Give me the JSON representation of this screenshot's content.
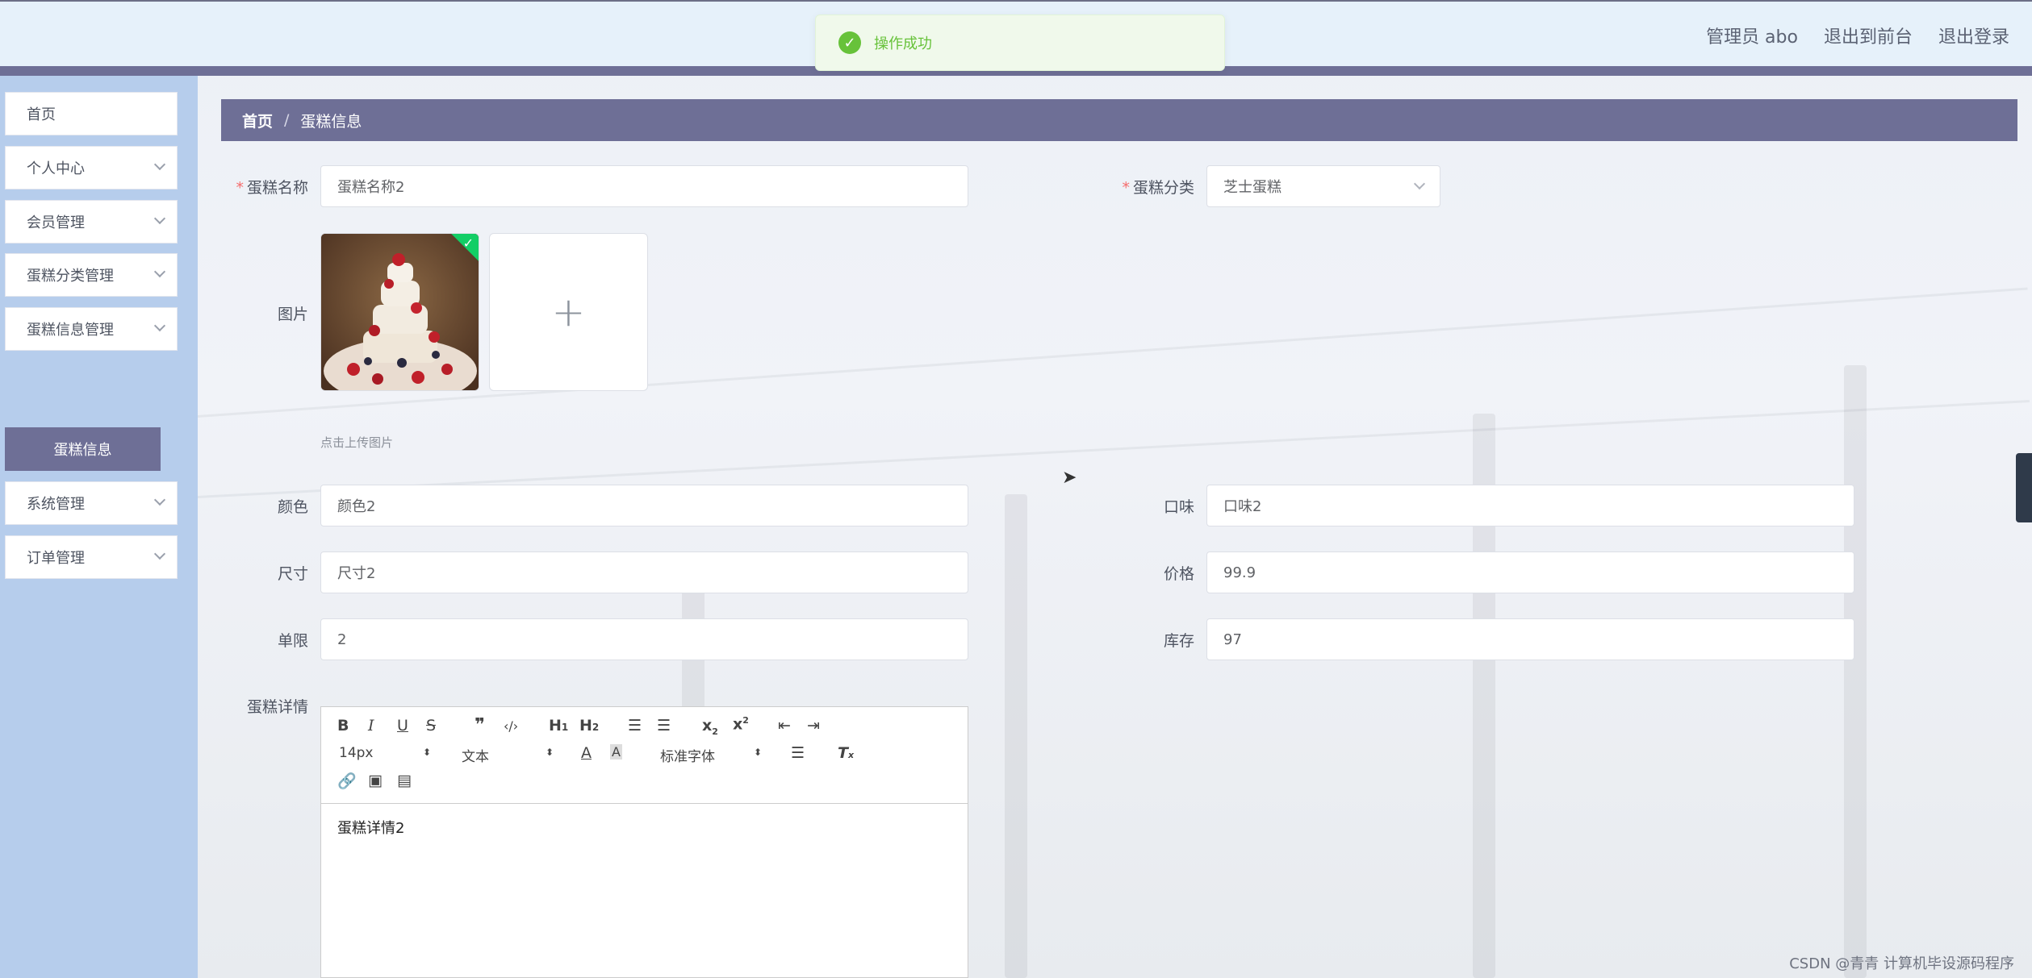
{
  "header": {
    "admin_label": "管理员 abo",
    "front_link": "退出到前台",
    "logout_link": "退出登录"
  },
  "toast": {
    "message": "操作成功"
  },
  "sidebar": {
    "items": [
      {
        "label": "首页"
      },
      {
        "label": "个人中心"
      },
      {
        "label": "会员管理"
      },
      {
        "label": "蛋糕分类管理"
      },
      {
        "label": "蛋糕信息管理"
      },
      {
        "label": "系统管理"
      },
      {
        "label": "订单管理"
      }
    ],
    "active_sub": "蛋糕信息"
  },
  "breadcrumb": {
    "home": "首页",
    "separator": "/",
    "current": "蛋糕信息"
  },
  "form": {
    "name": {
      "label": "蛋糕名称",
      "value": "蛋糕名称2"
    },
    "category": {
      "label": "蛋糕分类",
      "value": "芝士蛋糕"
    },
    "image": {
      "label": "图片",
      "upload_tip": "点击上传图片",
      "add_symbol": "+"
    },
    "color": {
      "label": "颜色",
      "value": "颜色2"
    },
    "flavor": {
      "label": "口味",
      "value": "口味2"
    },
    "size": {
      "label": "尺寸",
      "value": "尺寸2"
    },
    "price": {
      "label": "价格",
      "value": "99.9"
    },
    "limit": {
      "label": "单限",
      "value": "2"
    },
    "stock": {
      "label": "库存",
      "value": "97"
    },
    "detail": {
      "label": "蛋糕详情",
      "content": "蛋糕详情2",
      "font_size": "14px",
      "block_format": "文本",
      "font_family": "标准字体"
    }
  },
  "watermark": "CSDN @青青  计算机毕设源码程序"
}
